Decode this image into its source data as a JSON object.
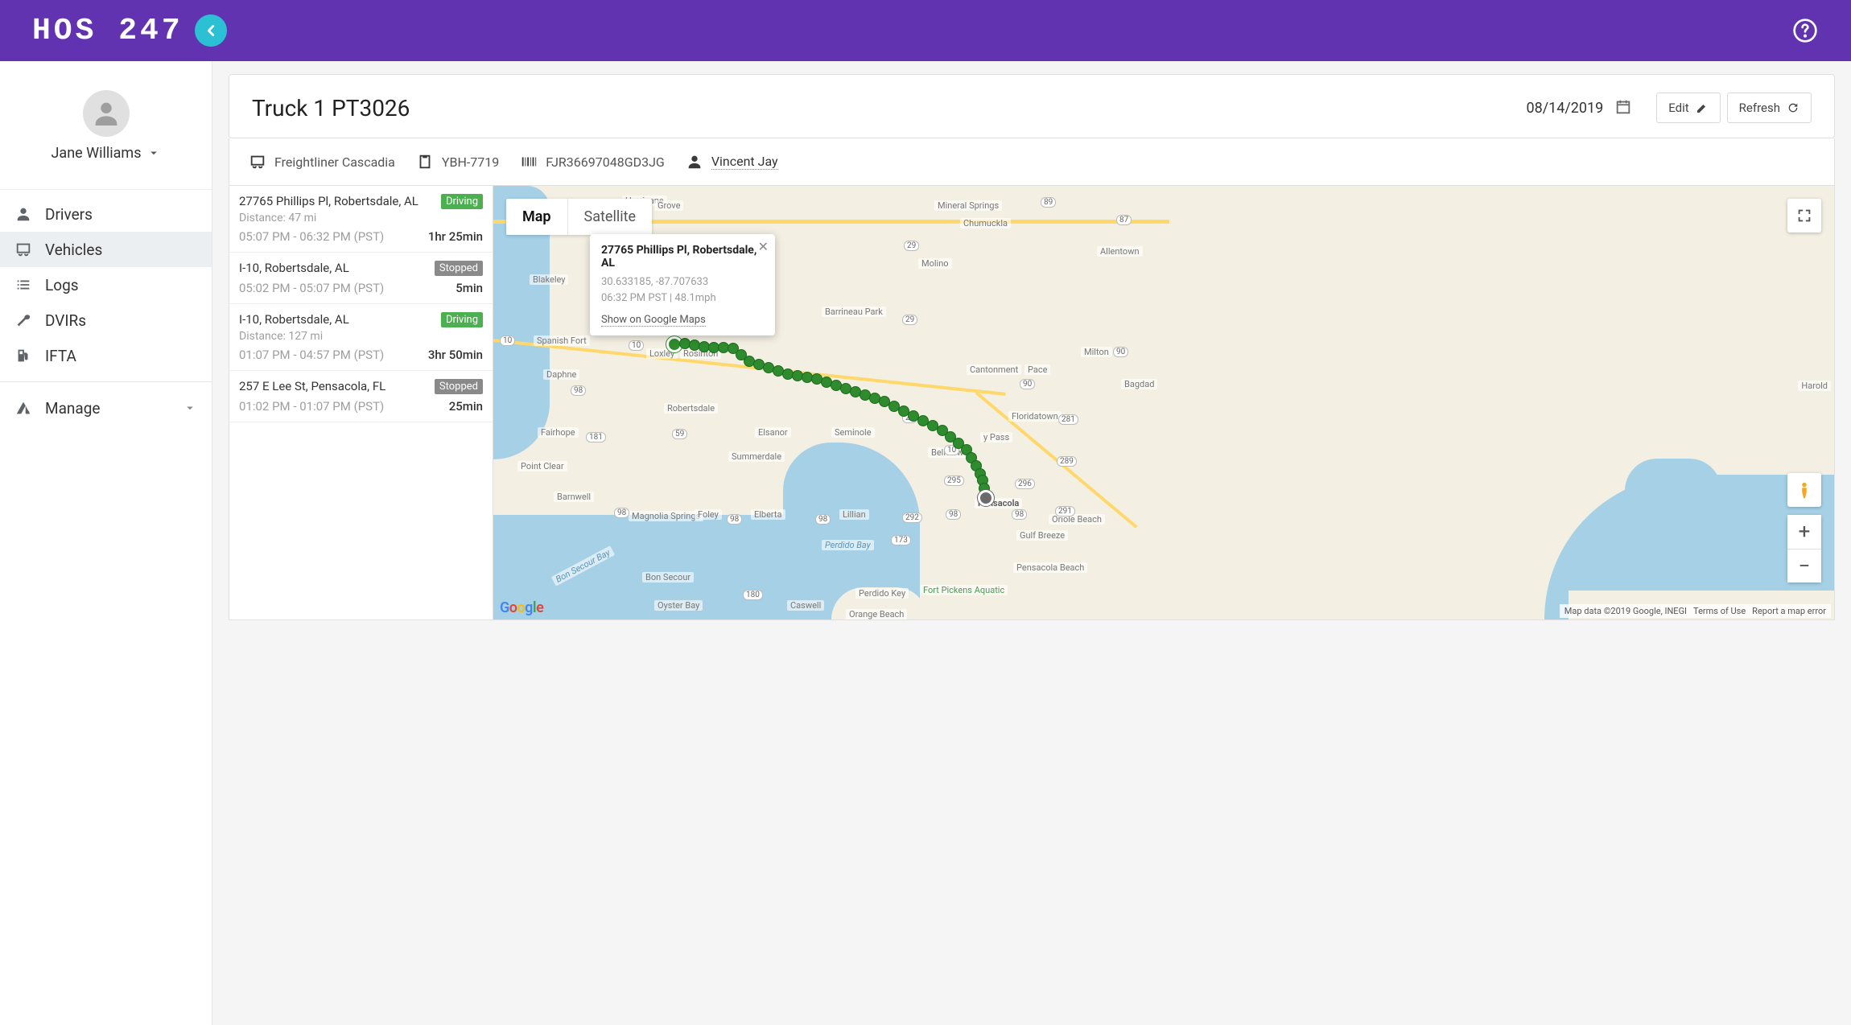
{
  "topbar": {
    "logo": "HOS 247"
  },
  "profile": {
    "name": "Jane Williams"
  },
  "nav": {
    "drivers": "Drivers",
    "vehicles": "Vehicles",
    "logs": "Logs",
    "dvirs": "DVIRs",
    "ifta": "IFTA",
    "manage": "Manage"
  },
  "header": {
    "title": "Truck 1 PT3026",
    "date": "08/14/2019",
    "edit": "Edit",
    "refresh": "Refresh"
  },
  "meta": {
    "vehicle_model": "Freightliner Cascadia",
    "plate": "YBH-7719",
    "vin": "FJR36697048GD3JG",
    "driver": "Vincent Jay"
  },
  "trips": [
    {
      "address": "27765 Phillips Pl, Robertsdale, AL",
      "status": "Driving",
      "distance": "Distance: 47 mi",
      "range": "05:07 PM - 06:32 PM (PST)",
      "duration": "1hr 25min"
    },
    {
      "address": "I-10, Robertsdale, AL",
      "status": "Stopped",
      "distance": "",
      "range": "05:02 PM - 05:07 PM (PST)",
      "duration": "5min"
    },
    {
      "address": "I-10, Robertsdale, AL",
      "status": "Driving",
      "distance": "Distance: 127 mi",
      "range": "01:07 PM - 04:57 PM (PST)",
      "duration": "3hr 50min"
    },
    {
      "address": "257 E Lee St, Pensacola, FL",
      "status": "Stopped",
      "distance": "",
      "range": "01:02 PM - 01:07 PM (PST)",
      "duration": "25min"
    }
  ],
  "map": {
    "tab_map": "Map",
    "tab_sat": "Satellite",
    "info": {
      "title": "27765 Phillips Pl, Robertsdale, AL",
      "coords": "30.633185, -87.707633",
      "time_speed": "06:32 PM PST | 48.1mph",
      "link": "Show on Google Maps"
    },
    "footer": {
      "data": "Map data ©2019 Google, INEGI",
      "terms": "Terms of Use",
      "report": "Report a map error"
    },
    "places": {
      "spanishfort": "Spanish Fort",
      "loxley": "Loxley",
      "rosinton": "Rosinton",
      "robertsdale": "Robertsdale",
      "daphne": "Daphne",
      "fairhope": "Fairhope",
      "pointclear": "Point Clear",
      "barnwell": "Barnwell",
      "magnolia": "Magnolia Springs",
      "foley": "Foley",
      "elberta": "Elberta",
      "summerdale": "Summerdale",
      "elsanor": "Elsanor",
      "seminole": "Seminole",
      "lillian": "Lillian",
      "cantonment": "Cantonment",
      "barrineau": "Barrineau Park",
      "molino": "Molino",
      "chumuckla": "Chumuckla",
      "mineral": "Mineral Springs",
      "milton": "Milton",
      "pace": "Pace",
      "bagdad": "Bagdad",
      "harold": "Harold",
      "allentown": "Allentown",
      "floridatown": "Floridatown",
      "bellview": "Bellview",
      "pensacola": "Pensacola",
      "pbeach": "Pensacola Beach",
      "obeach": "Oriole Beach",
      "gulfbreeze": "Gulf Breeze",
      "orangebeach": "Orange Beach",
      "perdidokey": "Perdido Key",
      "caswell": "Caswell",
      "bonsecour": "Bon Secour",
      "oysterbay": "Oyster Bay",
      "blakeley": "Blakeley",
      "hurricane": "Hurricane",
      "grove": "Grove",
      "fortpickens": "Fort Pickens Aquatic",
      "ypass": "y Pass",
      "perdidobay": "Perdido Bay",
      "bonsecourbay": "Bon Secour Bay"
    }
  }
}
